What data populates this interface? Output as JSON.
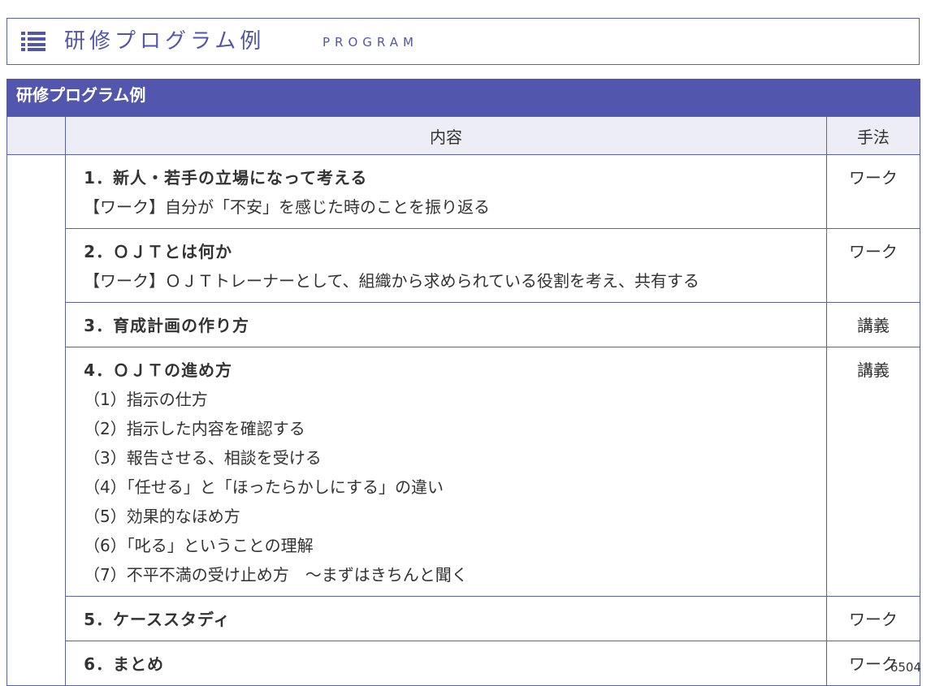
{
  "header": {
    "title": "研修プログラム例",
    "subtitle": "PROGRAM"
  },
  "table": {
    "title": "研修プログラム例",
    "col_content": "内容",
    "col_method": "手法",
    "rows": [
      {
        "heading": "1．新人・若手の立場になって考える",
        "lines": [
          "【ワーク】自分が「不安」を感じた時のことを振り返る"
        ],
        "method": "ワーク"
      },
      {
        "heading": "2．ＯＪＴとは何か",
        "lines": [
          "【ワーク】ＯＪＴトレーナーとして、組織から求められている役割を考え、共有する"
        ],
        "method": "ワーク"
      },
      {
        "heading": "3．育成計画の作り方",
        "lines": [],
        "method": "講義"
      },
      {
        "heading": "4．ＯＪＴの進め方",
        "lines": [
          "（1）指示の仕方",
          "（2）指示した内容を確認する",
          "（3）報告させる、相談を受ける",
          "（4）「任せる」と「ほったらかしにする」の違い",
          "（5）効果的なほめ方",
          "（6）「叱る」ということの理解",
          "（7）不平不満の受け止め方　～まずはきちんと聞く"
        ],
        "method": "講義"
      },
      {
        "heading": "5．ケーススタディ",
        "lines": [],
        "method": "ワーク"
      },
      {
        "heading": "6．まとめ",
        "lines": [],
        "method": "ワーク"
      }
    ]
  },
  "footer": {
    "code": "6504"
  },
  "colors": {
    "accent": "#5257ad",
    "header_bg": "#ecedf5",
    "border": "#5a5fae"
  },
  "icons": {
    "header": "list-icon"
  }
}
